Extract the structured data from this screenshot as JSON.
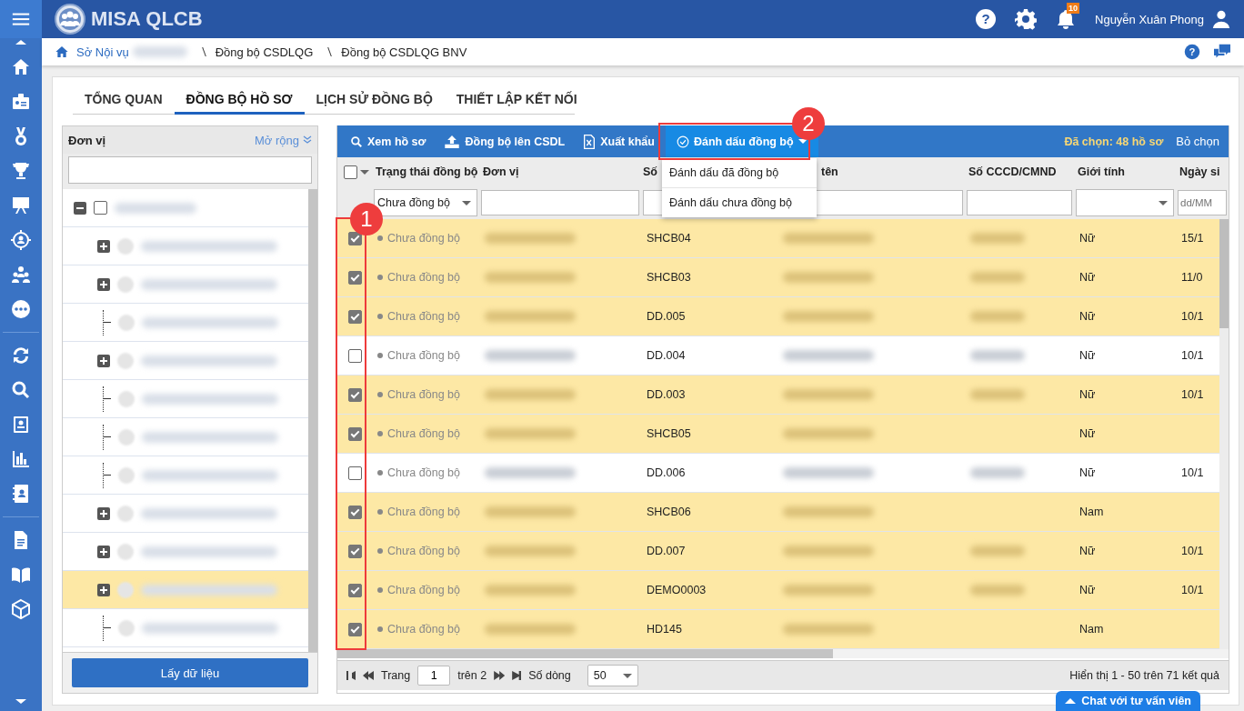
{
  "app": {
    "title": "MISA QLCB",
    "help": "?",
    "page_help": "?",
    "notifications": "10",
    "user": "Nguyễn Xuân Phong"
  },
  "breadcrumb": [
    {
      "label": "Sở Nội vụ",
      "link": true,
      "redacted": true
    },
    {
      "label": "Đồng bộ CSDLQG",
      "link": false,
      "redacted": false
    },
    {
      "label": "Đồng bộ CSDLQG BNV",
      "link": false,
      "redacted": false
    }
  ],
  "tabs": [
    {
      "label": "TỔNG QUAN",
      "selected": false
    },
    {
      "label": "ĐỒNG BỘ HỒ SƠ",
      "selected": true
    },
    {
      "label": "LỊCH SỬ ĐỒNG BỘ",
      "selected": false
    },
    {
      "label": "THIẾT LẬP KẾT NỐI",
      "selected": false
    }
  ],
  "unit_panel": {
    "title": "Đơn vị",
    "expand_label": "Mở rộng",
    "button": "Lấy dữ liệu",
    "tree": [
      {
        "kind": "group",
        "expanded": true,
        "checked": false,
        "selected": false,
        "children": [
          {
            "kind": "group",
            "expanded": false,
            "selected": false
          },
          {
            "kind": "group",
            "expanded": false,
            "selected": false
          },
          {
            "kind": "leaf",
            "selected": false
          },
          {
            "kind": "group",
            "expanded": false,
            "selected": false
          },
          {
            "kind": "leaf",
            "selected": false
          },
          {
            "kind": "leaf",
            "selected": false
          },
          {
            "kind": "leaf",
            "selected": false
          },
          {
            "kind": "group",
            "expanded": false,
            "selected": false
          },
          {
            "kind": "group",
            "expanded": false,
            "selected": false
          },
          {
            "kind": "group",
            "expanded": false,
            "selected": true
          },
          {
            "kind": "leaf",
            "selected": false
          }
        ]
      }
    ]
  },
  "toolbar": {
    "buttons": [
      {
        "label": "Xem hồ sơ",
        "kind": "view",
        "open": false
      },
      {
        "label": "Đồng bộ lên CSDL",
        "kind": "upload",
        "open": false
      },
      {
        "label": "Xuất khẩu",
        "kind": "export",
        "open": false
      },
      {
        "label": "Đánh dấu đồng bộ",
        "kind": "mark",
        "open": true
      }
    ],
    "menu": [
      "Đánh dấu đã đồng bộ",
      "Đánh dấu chưa đồng bộ"
    ],
    "selected_count": "Đã chọn: 48 hồ sơ",
    "clear": "Bỏ chọn"
  },
  "table": {
    "all_checked": false,
    "columns": [
      {
        "label": "Trạng thái đồng bộ",
        "filter": {
          "kind": "select",
          "value": "Chưa đồng bộ"
        }
      },
      {
        "label": "Đơn vị",
        "filter": {
          "kind": "text"
        }
      },
      {
        "label": "Số",
        "filter": {
          "kind": "text"
        }
      },
      {
        "label": "tên",
        "filter": {
          "kind": "text"
        }
      },
      {
        "label": "Số CCCD/CMND",
        "filter": {
          "kind": "text"
        }
      },
      {
        "label": "Giới tính",
        "filter": {
          "kind": "select"
        }
      },
      {
        "label": "Ngày si",
        "filter": {
          "kind": "text",
          "placeholder": "dd/MM"
        }
      }
    ],
    "rows": [
      {
        "checked": true,
        "status": "Chưa đồng bộ",
        "code": "SHCB04",
        "id_shown": true,
        "gender": "Nữ",
        "date": "15/1"
      },
      {
        "checked": true,
        "status": "Chưa đồng bộ",
        "code": "SHCB03",
        "id_shown": true,
        "gender": "Nữ",
        "date": "11/0"
      },
      {
        "checked": true,
        "status": "Chưa đồng bộ",
        "code": "DD.005",
        "id_shown": true,
        "gender": "Nữ",
        "date": "10/1"
      },
      {
        "checked": false,
        "status": "Chưa đồng bộ",
        "code": "DD.004",
        "id_shown": true,
        "gender": "Nữ",
        "date": "10/1"
      },
      {
        "checked": true,
        "status": "Chưa đồng bộ",
        "code": "DD.003",
        "id_shown": true,
        "gender": "Nữ",
        "date": "10/1"
      },
      {
        "checked": true,
        "status": "Chưa đồng bộ",
        "code": "SHCB05",
        "id_shown": false,
        "gender": "Nữ"
      },
      {
        "checked": false,
        "status": "Chưa đồng bộ",
        "code": "DD.006",
        "id_shown": true,
        "gender": "Nữ",
        "date": "10/1"
      },
      {
        "checked": true,
        "status": "Chưa đồng bộ",
        "code": "SHCB06",
        "id_shown": false,
        "gender": "Nam"
      },
      {
        "checked": true,
        "status": "Chưa đồng bộ",
        "code": "DD.007",
        "id_shown": true,
        "gender": "Nữ",
        "date": "10/1"
      },
      {
        "checked": true,
        "status": "Chưa đồng bộ",
        "code": "DEMO0003",
        "id_shown": true,
        "gender": "Nữ",
        "date": "10/1"
      },
      {
        "checked": true,
        "status": "Chưa đồng bộ",
        "code": "HD145",
        "id_shown": false,
        "gender": "Nam"
      }
    ]
  },
  "pager": {
    "page_label": "Trang",
    "page": "1",
    "of_pages": "trên 2",
    "rows_label": "Số dòng",
    "rows_per_page": "50",
    "summary": "Hiển thị 1 - 50 trên 71 kết quả"
  },
  "chat": {
    "label": "Chat với tư vấn viên"
  },
  "callouts": [
    {
      "number": "1"
    },
    {
      "number": "2"
    }
  ]
}
